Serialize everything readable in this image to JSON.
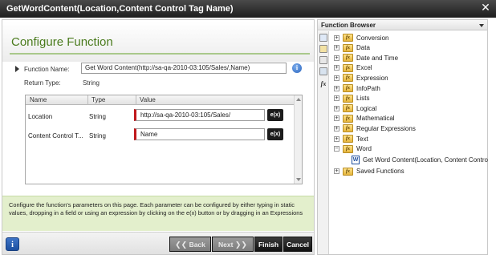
{
  "window": {
    "title": "GetWordContent(Location,Content Control Tag Name)",
    "close_glyph": "✕"
  },
  "configure": {
    "heading": "Configure Function",
    "function_name_label": "Function Name:",
    "function_name_value": "Get Word Content(http://sa-qa-2010-03:105/Sales/,Name)",
    "return_type_label": "Return Type:",
    "return_type_value": "String",
    "info_glyph": "i"
  },
  "parameters": {
    "columns": [
      "Name",
      "Type",
      "Value"
    ],
    "rows": [
      {
        "name": "Location",
        "type": "String",
        "value": "http://sa-qa-2010-03:105/Sales/",
        "button": "e(x)"
      },
      {
        "name": "Content Control T...",
        "type": "String",
        "value": "Name",
        "button": "e(x)"
      }
    ]
  },
  "help_text": "Configure the function's parameters on this page. Each parameter can be configured by either typing in static values, dropping in a field or using an expression by clicking on the e(x) button or by dragging in an Expressions",
  "footer": {
    "info_glyph": "i",
    "back_label": "Back",
    "next_label": "Next",
    "finish_label": "Finish",
    "cancel_label": "Cancel",
    "back_arrow": "❮❮",
    "next_arrow": "❯❯"
  },
  "function_browser": {
    "title": "Function Browser",
    "toolbar_fx": "fx",
    "folder_glyph": "fx",
    "items": [
      {
        "label": "Conversion",
        "expander": "+"
      },
      {
        "label": "Data",
        "expander": "+"
      },
      {
        "label": "Date and Time",
        "expander": "+"
      },
      {
        "label": "Excel",
        "expander": "+"
      },
      {
        "label": "Expression",
        "expander": "+"
      },
      {
        "label": "InfoPath",
        "expander": "+"
      },
      {
        "label": "Lists",
        "expander": "+"
      },
      {
        "label": "Logical",
        "expander": "+"
      },
      {
        "label": "Mathematical",
        "expander": "+"
      },
      {
        "label": "Regular Expressions",
        "expander": "+"
      },
      {
        "label": "Text",
        "expander": "+"
      },
      {
        "label": "Word",
        "expander": "−"
      }
    ],
    "word_child": {
      "label": "Get Word Content(Location, Content Contro",
      "icon": "W"
    },
    "saved": {
      "label": "Saved Functions",
      "expander": "+"
    }
  },
  "colors": {
    "heading_green": "#4a7b1d",
    "help_bg": "#e3efcc",
    "required_red": "#c0181c"
  }
}
